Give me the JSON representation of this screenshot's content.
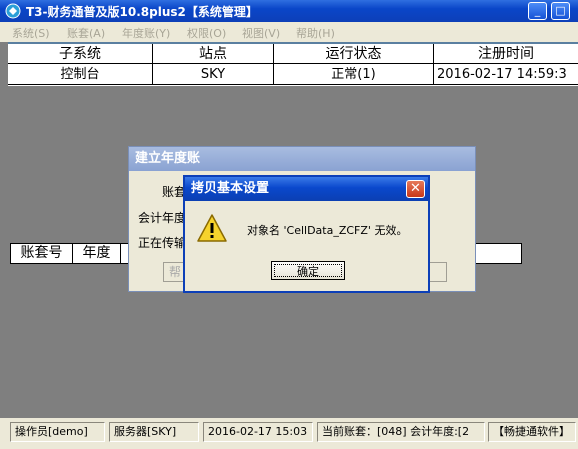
{
  "window": {
    "title": "T3-财务通普及版10.8plus2【系统管理】",
    "min": "_",
    "max": "□",
    "close": "✕"
  },
  "menu": [
    "系统(S)",
    "账套(A)",
    "年度账(Y)",
    "权限(O)",
    "视图(V)",
    "帮助(H)"
  ],
  "grid": {
    "headers": [
      "子系统",
      "站点",
      "运行状态",
      "注册时间"
    ],
    "rows": [
      [
        "控制台",
        "SKY",
        "正常(1)",
        "2016-02-17 14:59:3"
      ]
    ]
  },
  "account_grid": {
    "headers": [
      "账套号",
      "年度"
    ]
  },
  "bg_dialog": {
    "title": "建立年度账",
    "label1": "账套",
    "label2": "会计年度",
    "label3": "正在传输",
    "button_partial": "帮"
  },
  "alert": {
    "title": "拷贝基本设置",
    "message": "对象名 'CellData_ZCFZ' 无效。",
    "ok": "确定",
    "icon": "warning-icon"
  },
  "status": {
    "operator": "操作员[demo]",
    "server": "服务器[SKY]",
    "datetime": "2016-02-17 15:03",
    "current": "当前账套：[048] 会计年度:[2",
    "brand": "【畅捷通软件】"
  }
}
